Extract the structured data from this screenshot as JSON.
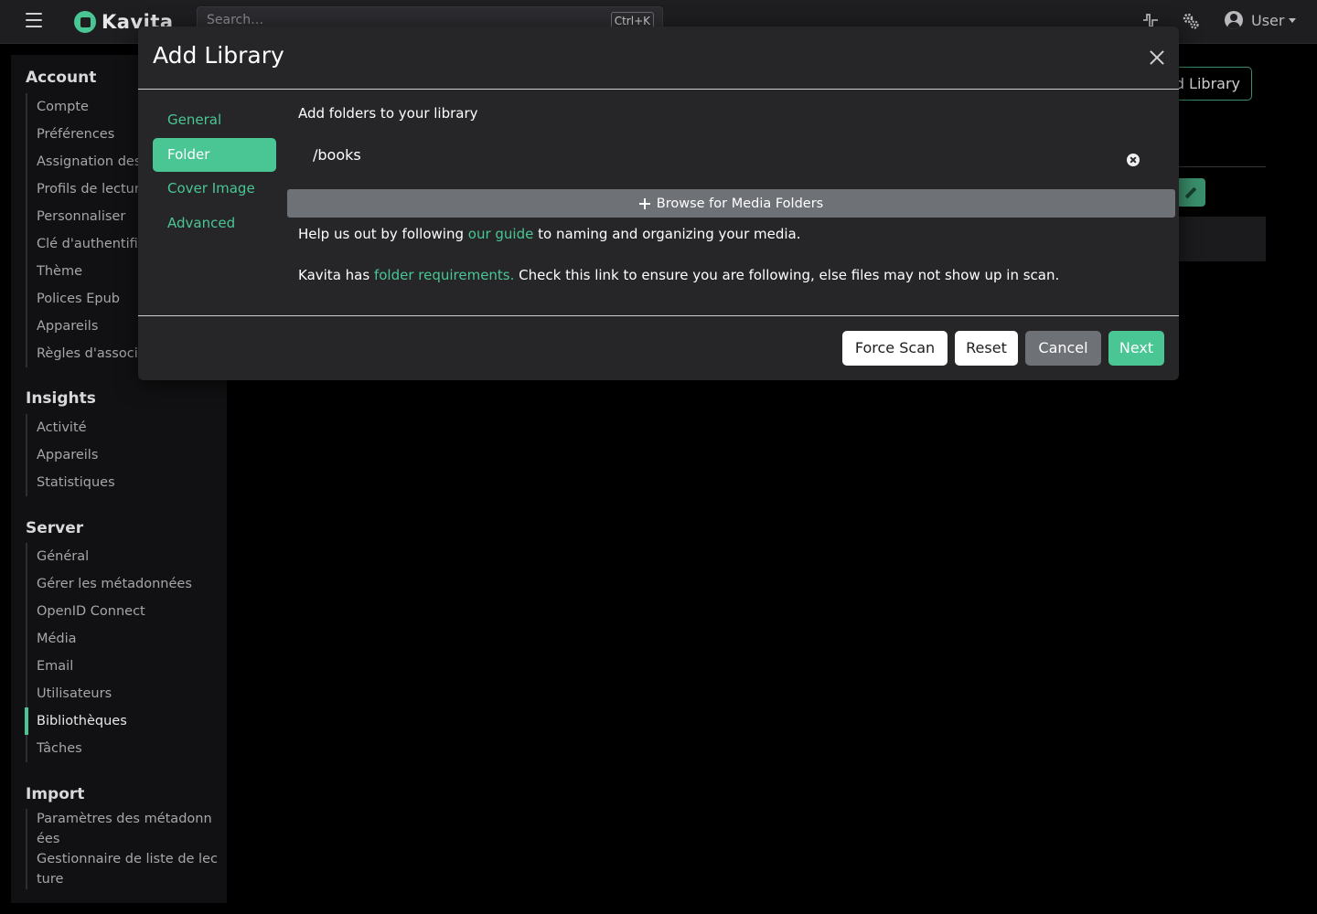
{
  "topbar": {
    "brand": "Kavita",
    "search_placeholder": "Search…",
    "search_shortcut": "Ctrl+K",
    "user_label": "User"
  },
  "sidebar": {
    "sections": [
      {
        "title": "Account",
        "items": [
          "Compte",
          "Préférences",
          "Assignation des",
          "Profils de lecture",
          "Personnaliser",
          "Clé d'authentification",
          "Thème",
          "Polices Epub",
          "Appareils",
          "Règles d'association"
        ]
      },
      {
        "title": "Insights",
        "items": [
          "Activité",
          "Appareils",
          "Statistiques"
        ]
      },
      {
        "title": "Server",
        "items": [
          "Général",
          "Gérer les métadonnées",
          "OpenID Connect",
          "Média",
          "Email",
          "Utilisateurs",
          "Bibliothèques",
          "Tâches"
        ],
        "active_index": 6
      },
      {
        "title": "Import",
        "items": [
          "Paramètres des métadonnées",
          "Gestionnaire de liste de lecture"
        ]
      }
    ]
  },
  "background": {
    "add_library_label": "d Library"
  },
  "modal": {
    "title": "Add Library",
    "tabs": [
      "General",
      "Folder",
      "Cover Image",
      "Advanced"
    ],
    "active_tab": 1,
    "section_label": "Add folders to your library",
    "folders": [
      "/books"
    ],
    "browse_label": "Browse for Media Folders",
    "help1": {
      "before": "Help us out by following ",
      "link": "our guide",
      "after": " to naming and organizing your media."
    },
    "help2": {
      "before": "Kavita has ",
      "link": "folder requirements.",
      "after": " Check this link to ensure you are following, else files may not show up in scan."
    },
    "buttons": {
      "force_scan": "Force Scan",
      "reset": "Reset",
      "cancel": "Cancel",
      "next": "Next"
    }
  },
  "colors": {
    "accent": "#4ac694",
    "modal_bg": "#262629",
    "topbar_bg": "#1e1e21"
  }
}
